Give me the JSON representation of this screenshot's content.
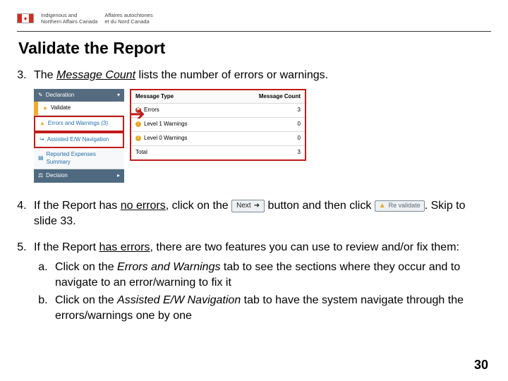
{
  "header": {
    "dept_en_line1": "Indigenous and",
    "dept_en_line2": "Northern Affairs Canada",
    "dept_fr_line1": "Affaires autochtones",
    "dept_fr_line2": "et du Nord Canada"
  },
  "title": "Validate the Report",
  "steps": {
    "s3": {
      "pre": "The ",
      "term": "Message Count",
      "post": " lists the number of errors or warnings."
    },
    "s4": {
      "a": "If the Report has ",
      "no_errors": "no errors",
      "b": ", click on the ",
      "c": " button and then click ",
      "d": ".  Skip to slide 33."
    },
    "s5": {
      "a": "If the Report ",
      "has_errors": "has errors",
      "b": ", there are two features you can use to review and/or fix them:",
      "sa": {
        "pre": "Click on the ",
        "term": "Errors and Warnings",
        "post": " tab to see the sections where they occur and to navigate to an error/warning to fix it"
      },
      "sb": {
        "pre": "Click on the ",
        "term": "Assisted E/W Navigation",
        "post": " tab to have the system navigate through the errors/warnings one by one"
      }
    }
  },
  "buttons": {
    "next": "Next",
    "revalidate": "Re validate"
  },
  "nav": {
    "declaration": "Declaration",
    "validate": "Validate",
    "errwarn": "Errors and Warnings (3)",
    "assisted": "Assisted E/W Navigation",
    "reported": "Reported Expenses Summary",
    "decision": "Decision"
  },
  "table": {
    "col1": "Message Type",
    "col2": "Message Count",
    "rows": [
      {
        "label": "Errors",
        "count": "3",
        "icon": "err"
      },
      {
        "label": "Level 1 Warnings",
        "count": "0",
        "icon": "warn"
      },
      {
        "label": "Level 0 Warnings",
        "count": "0",
        "icon": "warn"
      },
      {
        "label": "Total",
        "count": "3",
        "icon": ""
      }
    ]
  },
  "page_number": "30"
}
